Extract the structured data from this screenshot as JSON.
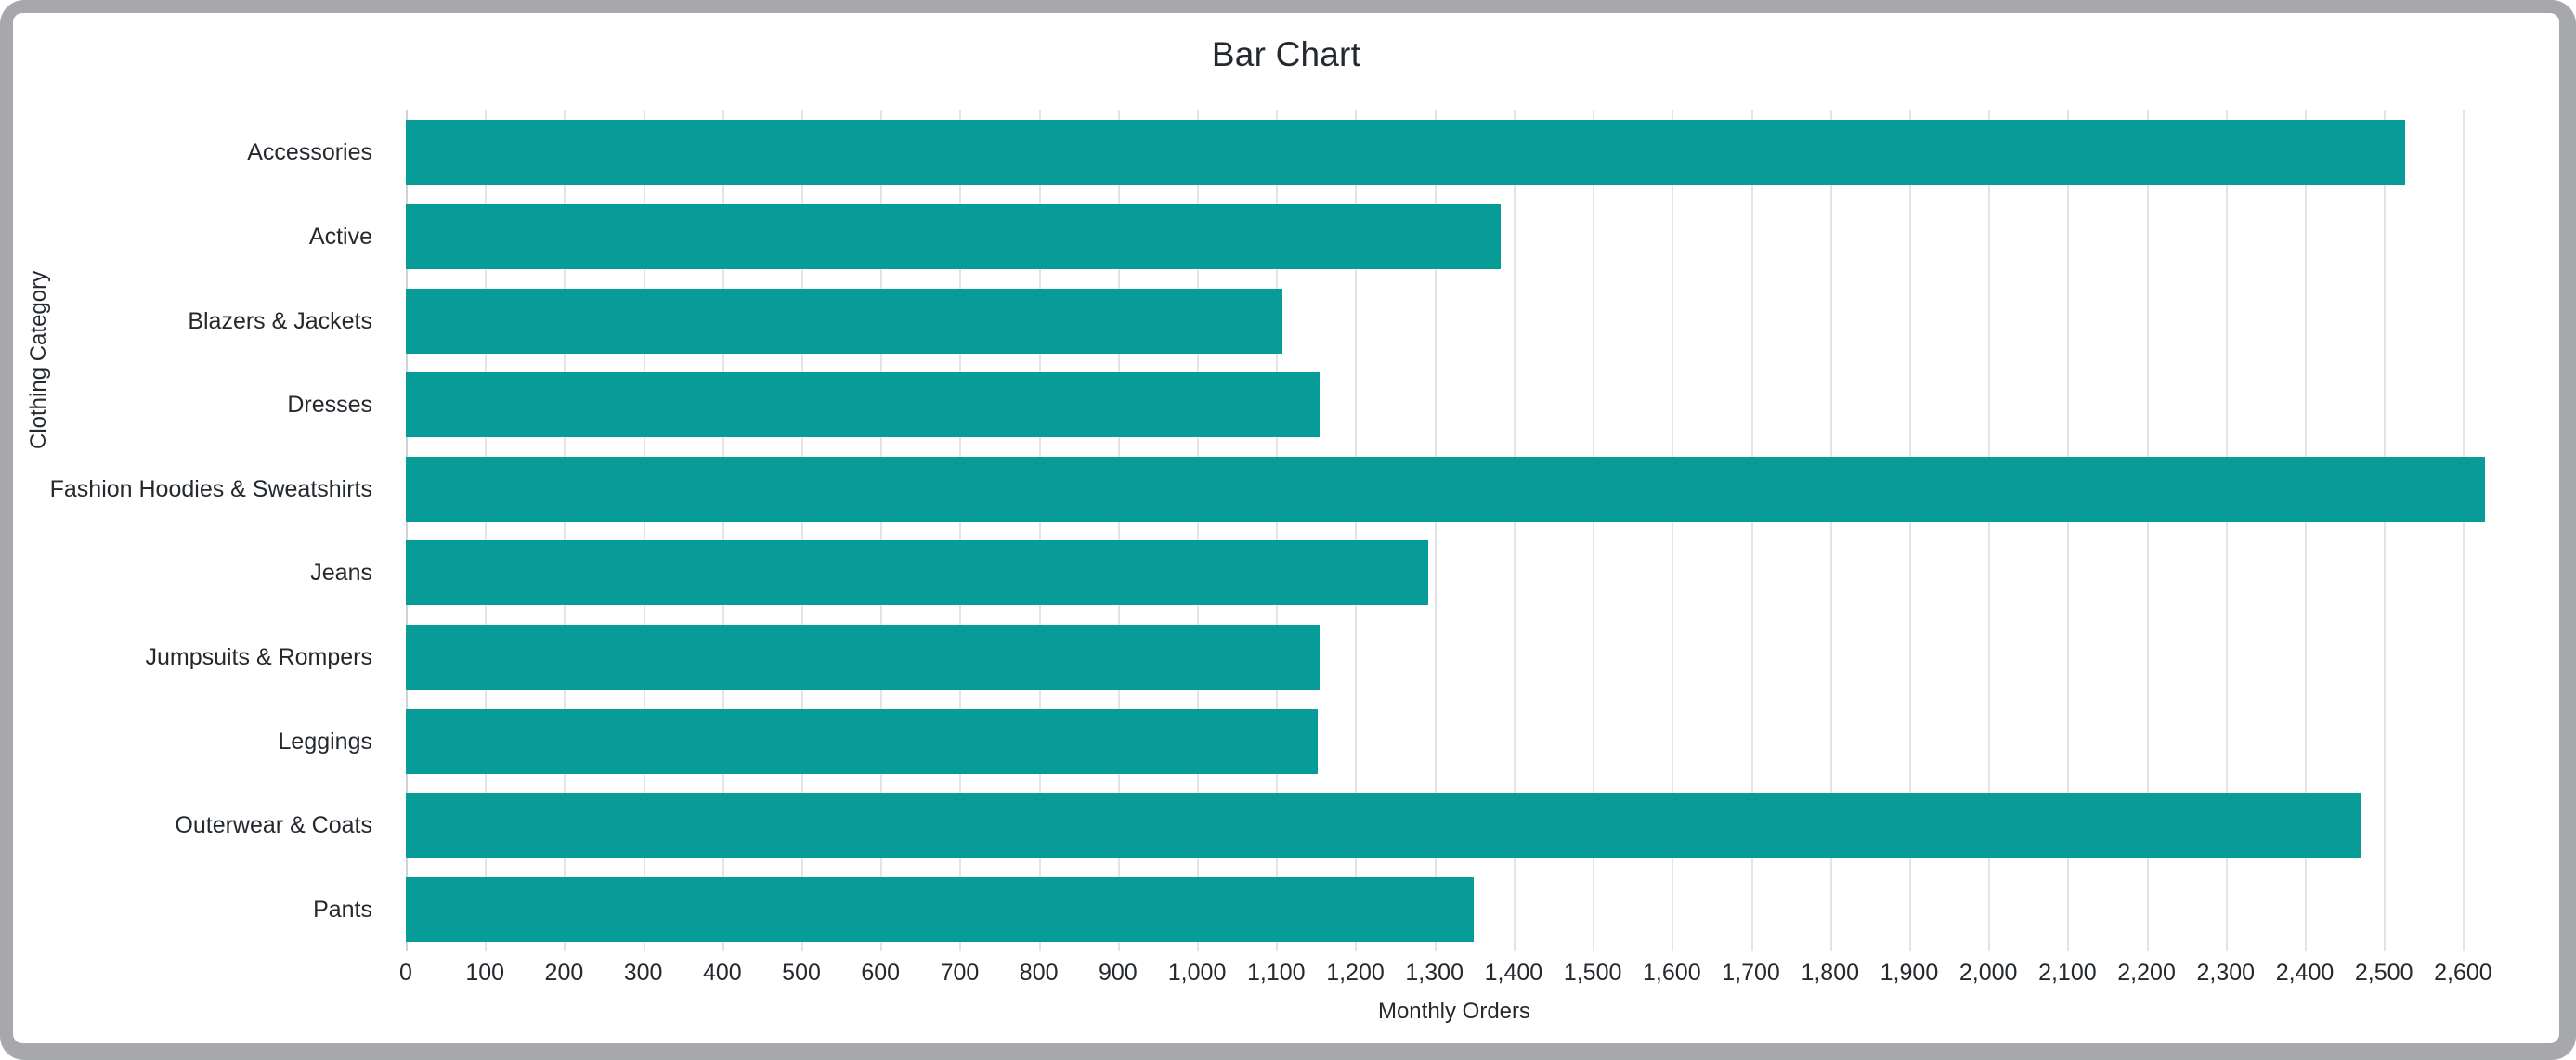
{
  "chart_data": {
    "type": "bar",
    "orientation": "horizontal",
    "title": "Bar Chart",
    "xlabel": "Monthly Orders",
    "ylabel": "Clothing Category",
    "categories": [
      "Accessories",
      "Active",
      "Blazers & Jackets",
      "Dresses",
      "Fashion Hoodies & Sweatshirts",
      "Jeans",
      "Jumpsuits & Rompers",
      "Leggings",
      "Outerwear & Coats",
      "Pants"
    ],
    "values": [
      2527,
      1384,
      1108,
      1155,
      2628,
      1292,
      1155,
      1153,
      2471,
      1350
    ],
    "xlim": [
      0,
      2650
    ],
    "ylim": null,
    "xticks": [
      0,
      100,
      200,
      300,
      400,
      500,
      600,
      700,
      800,
      900,
      1000,
      1100,
      1200,
      1300,
      1400,
      1500,
      1600,
      1700,
      1800,
      1900,
      2000,
      2100,
      2200,
      2300,
      2400,
      2500,
      2600
    ],
    "xtick_labels": [
      "0",
      "100",
      "200",
      "300",
      "400",
      "500",
      "600",
      "700",
      "800",
      "900",
      "1,000",
      "1,100",
      "1,200",
      "1,300",
      "1,400",
      "1,500",
      "1,600",
      "1,700",
      "1,800",
      "1,900",
      "2,000",
      "2,100",
      "2,200",
      "2,300",
      "2,400",
      "2,500",
      "2,600"
    ],
    "grid": {
      "x": true,
      "y": false
    },
    "legend": null,
    "bar_color": "#089c99",
    "gridline_color": "#e2e4e6",
    "text_color": "#24292e",
    "background_color": "#ffffff"
  }
}
